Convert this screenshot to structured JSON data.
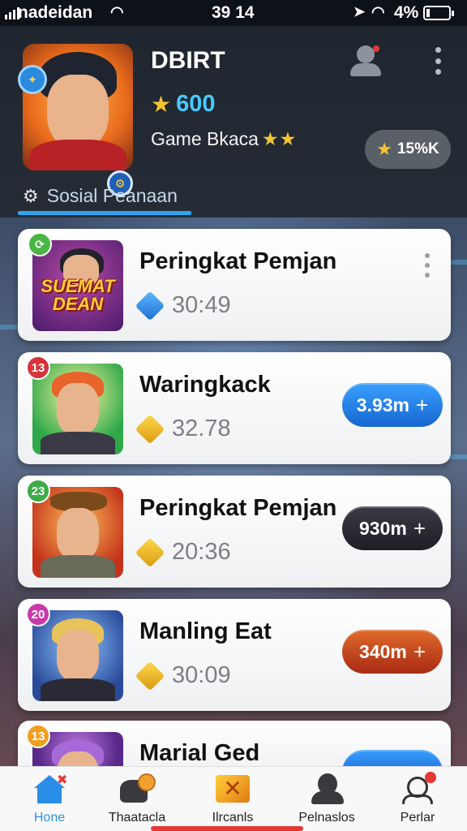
{
  "status_bar": {
    "carrier": "nadeidan",
    "time": "39 14",
    "battery": "4%"
  },
  "profile": {
    "name": "DBIRT",
    "coins": "600",
    "rank_label": "Game Bkaca",
    "boost": "15%K",
    "section_tab": "Sosial Peanaan"
  },
  "list": [
    {
      "title": "Peringkat Pemjan",
      "value": "30:49",
      "thumb_text": "SUEMAT DEAN",
      "has_menu": true
    },
    {
      "title": "Waringkack",
      "value": "32.78",
      "badge": "13",
      "action": "3.93m"
    },
    {
      "title": "Peringkat Pemjan",
      "value": "20:36",
      "badge": "23",
      "action": "930m"
    },
    {
      "title": "Manling Eat",
      "value": "30:09",
      "badge": "20",
      "action": "340m"
    },
    {
      "title": "Marial Ged",
      "badge": "13"
    }
  ],
  "bottom_nav": [
    {
      "label": "Hone",
      "icon": "home-icon",
      "active": true
    },
    {
      "label": "Thaatacla",
      "icon": "battle-icon"
    },
    {
      "label": "Ilrcanls",
      "icon": "trophy-icon"
    },
    {
      "label": "Pelnaslos",
      "icon": "profile-icon"
    },
    {
      "label": "Perlar",
      "icon": "player-icon"
    }
  ],
  "colors": {
    "accent": "#2ea6f0",
    "pill_blue": "#1f7fe0",
    "pill_dark": "#2b2b33",
    "pill_red": "#c8401c",
    "coin_text": "#48c9ff",
    "star": "#f6c431"
  }
}
